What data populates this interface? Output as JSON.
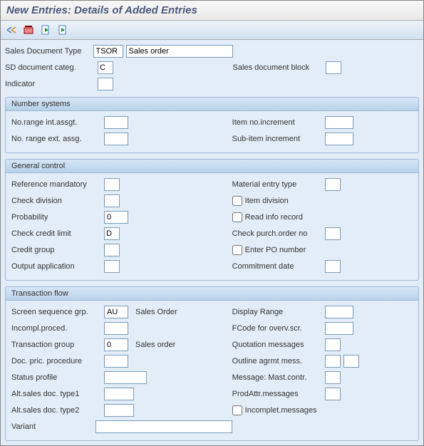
{
  "title": "New Entries: Details of Added Entries",
  "header_fields": {
    "sales_doc_type_label": "Sales Document Type",
    "sales_doc_type_value": "TSOR",
    "sales_doc_type_desc": "Sales order",
    "sd_doc_categ_label": "SD document categ.",
    "sd_doc_categ_value": "C",
    "sales_doc_block_label": "Sales document block",
    "indicator_label": "Indicator"
  },
  "number_systems": {
    "title": "Number systems",
    "range_int_label": "No.range int.assgt.",
    "range_ext_label": "No. range ext. assg.",
    "item_inc_label": "Item no.increment",
    "sub_item_inc_label": "Sub-item increment"
  },
  "general_control": {
    "title": "General control",
    "ref_mandatory_label": "Reference mandatory",
    "check_division_label": "Check division",
    "probability_label": "Probability",
    "probability_value": "0",
    "check_credit_label": "Check credit limit",
    "check_credit_value": "D",
    "credit_group_label": "Credit group",
    "output_app_label": "Output application",
    "material_entry_label": "Material entry type",
    "item_division_label": "Item division",
    "read_info_label": "Read info record",
    "check_po_label": "Check purch.order no",
    "enter_po_label": "Enter PO number",
    "commitment_label": "Commitment  date"
  },
  "transaction_flow": {
    "title": "Transaction flow",
    "screen_seq_label": "Screen sequence grp.",
    "screen_seq_value": "AU",
    "screen_seq_desc": "Sales Order",
    "incompl_proc_label": "Incompl.proced.",
    "trans_group_label": "Transaction group",
    "trans_group_value": "0",
    "trans_group_desc": "Sales order",
    "doc_pric_label": "Doc. pric. procedure",
    "status_profile_label": "Status profile",
    "alt_sales1_label": "Alt.sales doc. type1",
    "alt_sales2_label": "Alt.sales doc. type2",
    "variant_label": "Variant",
    "display_range_label": "Display Range",
    "fcode_label": "FCode for overv.scr.",
    "quotation_msg_label": "Quotation messages",
    "outline_agr_label": "Outline agrmt mess.",
    "message_mast_label": "Message: Mast.contr.",
    "prodattr_label": "ProdAttr.messages",
    "incomplet_label": "Incomplet.messages"
  }
}
